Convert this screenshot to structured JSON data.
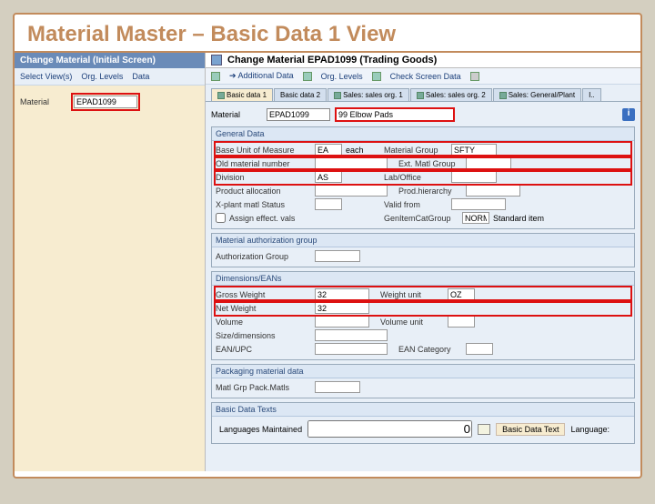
{
  "slide": {
    "title": "Material Master – Basic Data 1 View"
  },
  "left": {
    "window_title": "Change Material (Initial Screen)",
    "menu": {
      "select_views": "Select View(s)",
      "org_levels": "Org. Levels",
      "data": "Data"
    },
    "material_label": "Material",
    "material_value": "EPAD1099"
  },
  "right": {
    "window_title": "Change Material EPAD1099 (Trading Goods)",
    "toolbar": {
      "additional_data": "Additional Data",
      "org_levels": "Org. Levels",
      "check_screen": "Check Screen Data"
    },
    "tabs": {
      "basic1": "Basic data 1",
      "basic2": "Basic data 2",
      "sales1": "Sales: sales org. 1",
      "sales2": "Sales: sales org. 2",
      "salesgen": "Sales: General/Plant",
      "tail": "I.."
    },
    "material_label": "Material",
    "material_code": "EPAD1099",
    "material_desc": "99 Elbow Pads",
    "sections": {
      "general": {
        "head": "General Data",
        "base_uom": "Base Unit of Measure",
        "base_uom_val": "EA",
        "base_uom_txt": "each",
        "mat_group": "Material Group",
        "mat_group_val": "SFTY",
        "old_mat": "Old material number",
        "ext_mat": "Ext. Matl Group",
        "division": "Division",
        "division_val": "AS",
        "lab": "Lab/Office",
        "prod_alloc": "Product allocation",
        "prod_hier": "Prod.hierarchy",
        "xplant": "X-plant matl Status",
        "valid_from": "Valid from",
        "assign": "Assign effect. vals",
        "gencat": "GenItemCatGroup",
        "gencat_val": "NORM",
        "gencat_txt": "Standard item"
      },
      "auth": {
        "head": "Material authorization group",
        "auth_group": "Authorization Group"
      },
      "dim": {
        "head": "Dimensions/EANs",
        "gross": "Gross Weight",
        "gross_val": "32",
        "weight_unit": "Weight unit",
        "weight_unit_val": "OZ",
        "net": "Net Weight",
        "net_val": "32",
        "volume": "Volume",
        "volume_unit": "Volume unit",
        "size": "Size/dimensions",
        "ean": "EAN/UPC",
        "ean_cat": "EAN Category"
      },
      "pack": {
        "head": "Packaging material data",
        "matgrp": "Matl Grp Pack.Matls"
      },
      "texts": {
        "head": "Basic Data Texts",
        "lang_maint": "Languages Maintained",
        "lang_count": "0",
        "basic_text": "Basic Data Text",
        "language": "Language:"
      }
    }
  }
}
